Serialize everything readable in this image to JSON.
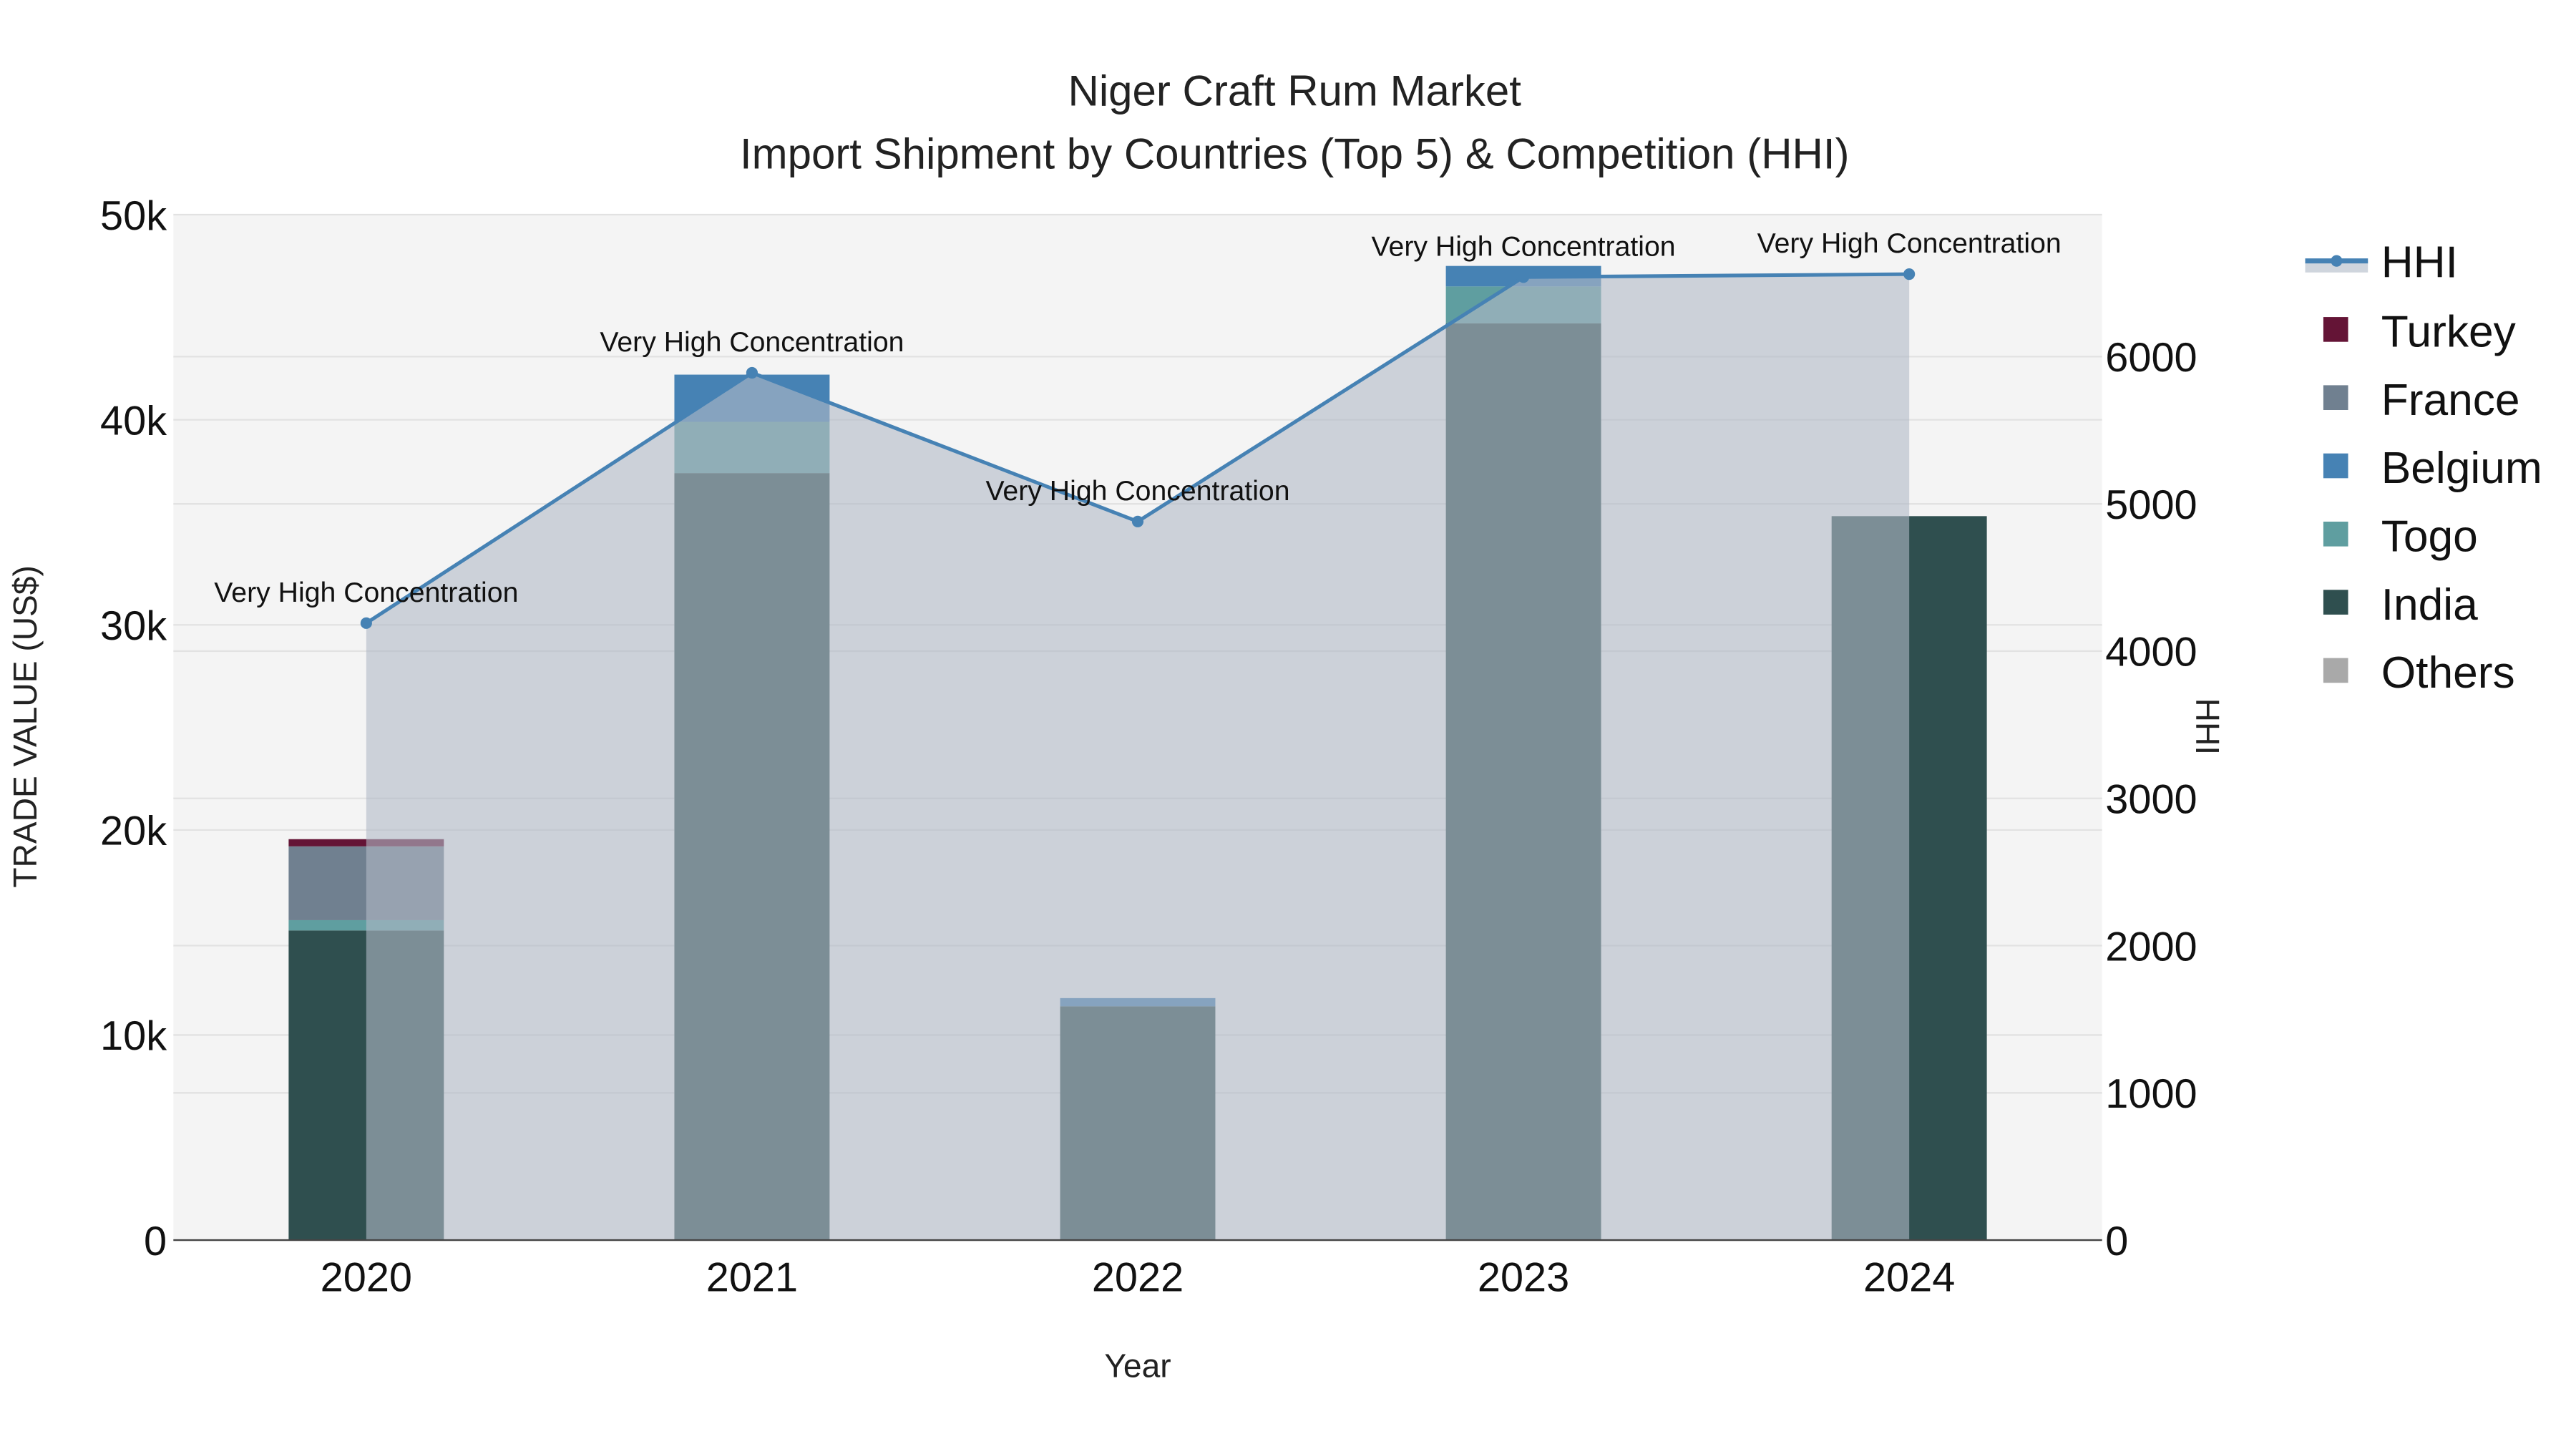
{
  "chart_data": {
    "type": "bar",
    "title": "Niger Craft Rum Market",
    "subtitle": "Import Shipment by Countries (Top 5) & Competition (HHI)",
    "xlabel": "Year",
    "ylabel": "TRADE VALUE (US$)",
    "y2label": "HHI",
    "categories": [
      "2020",
      "2021",
      "2022",
      "2023",
      "2024"
    ],
    "ylim": [
      0,
      50000
    ],
    "y2lim": [
      0,
      6964
    ],
    "yticks": [
      0,
      10000,
      20000,
      30000,
      40000,
      50000
    ],
    "ytick_labels": [
      "0",
      "10k",
      "20k",
      "30k",
      "40k",
      "50k"
    ],
    "y2ticks": [
      0,
      1000,
      2000,
      3000,
      4000,
      5000,
      6000
    ],
    "y2tick_labels": [
      "0",
      "1000",
      "2000",
      "3000",
      "4000",
      "5000",
      "6000"
    ],
    "grid": true,
    "barmode": "stack",
    "legend_position": "right",
    "series": [
      {
        "name": "India",
        "color": "#2F4F4F",
        "values": [
          15100,
          37400,
          11400,
          44700,
          35300
        ]
      },
      {
        "name": "Togo",
        "color": "#5F9EA0",
        "values": [
          500,
          2500,
          0,
          1800,
          0
        ]
      },
      {
        "name": "Belgium",
        "color": "#4682B4",
        "values": [
          0,
          2300,
          400,
          1000,
          0
        ]
      },
      {
        "name": "France",
        "color": "#708090",
        "values": [
          3600,
          0,
          0,
          0,
          0
        ]
      },
      {
        "name": "Turkey",
        "color": "#641436",
        "values": [
          350,
          0,
          0,
          0,
          0
        ]
      },
      {
        "name": "Others",
        "color": "#A9A9A9",
        "values": [
          0,
          0,
          0,
          0,
          0
        ]
      }
    ],
    "hhi": {
      "name": "HHI",
      "color": "#4682B4",
      "values": [
        4190,
        5890,
        4880,
        6540,
        6560
      ],
      "annotations": [
        "Very High Concentration",
        "Very High Concentration",
        "Very High Concentration",
        "Very High Concentration",
        "Very High Concentration"
      ]
    },
    "legend": [
      "HHI",
      "Turkey",
      "France",
      "Belgium",
      "Togo",
      "India",
      "Others"
    ]
  }
}
